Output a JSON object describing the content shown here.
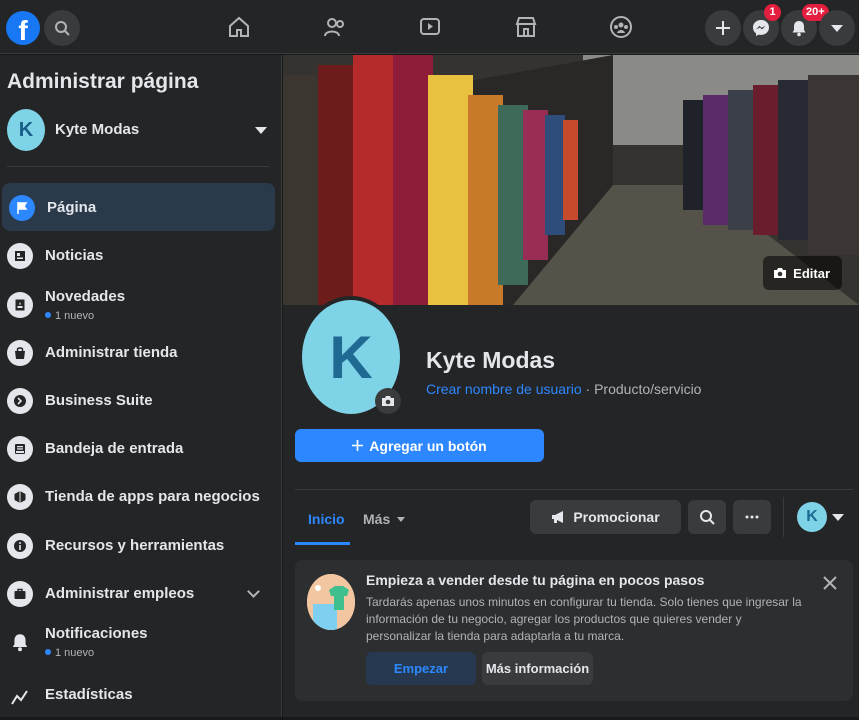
{
  "topbar": {
    "logo": "facebook-logo",
    "search": "search-icon",
    "nav": [
      "home-icon",
      "friends-icon",
      "watch-icon",
      "marketplace-icon",
      "groups-icon"
    ],
    "messenger_badge": "1",
    "notifications_badge": "20+"
  },
  "sidebar": {
    "title": "Administrar página",
    "page_name": "Kyte Modas",
    "avatar_letter": "K",
    "items": [
      {
        "label": "Página",
        "icon": "flag-icon"
      },
      {
        "label": "Noticias",
        "icon": "news-icon"
      },
      {
        "label": "Novedades",
        "icon": "updates-icon",
        "sub": "1 nuevo"
      },
      {
        "label": "Administrar tienda",
        "icon": "shop-bag-icon"
      },
      {
        "label": "Business Suite",
        "icon": "business-suite-icon"
      },
      {
        "label": "Bandeja de entrada",
        "icon": "inbox-icon"
      },
      {
        "label": "Tienda de apps para negocios",
        "icon": "app-store-icon"
      },
      {
        "label": "Recursos y herramientas",
        "icon": "info-icon"
      },
      {
        "label": "Administrar empleos",
        "icon": "briefcase-icon"
      },
      {
        "label": "Notificaciones",
        "icon": "bell-icon",
        "sub": "1 nuevo"
      },
      {
        "label": "Estadísticas",
        "icon": "stats-icon"
      }
    ]
  },
  "cover": {
    "edit_label": "Editar"
  },
  "profile": {
    "avatar_letter": "K",
    "name": "Kyte Modas",
    "username_link": "Crear nombre de usuario",
    "category": " · Producto/servicio",
    "add_button_label": "Agregar un botón"
  },
  "tabs": {
    "home": "Inicio",
    "more": "Más",
    "promote": "Promocionar",
    "avatar_letter": "K"
  },
  "card": {
    "title": "Empieza a vender desde tu página en pocos pasos",
    "text": "Tardarás apenas unos minutos en configurar tu tienda. Solo tienes que ingresar la información de tu negocio, agregar los productos que quieres vender y personalizar la tienda para adaptarla a tu marca.",
    "primary_button": "Empezar",
    "secondary_button": "Más información"
  }
}
